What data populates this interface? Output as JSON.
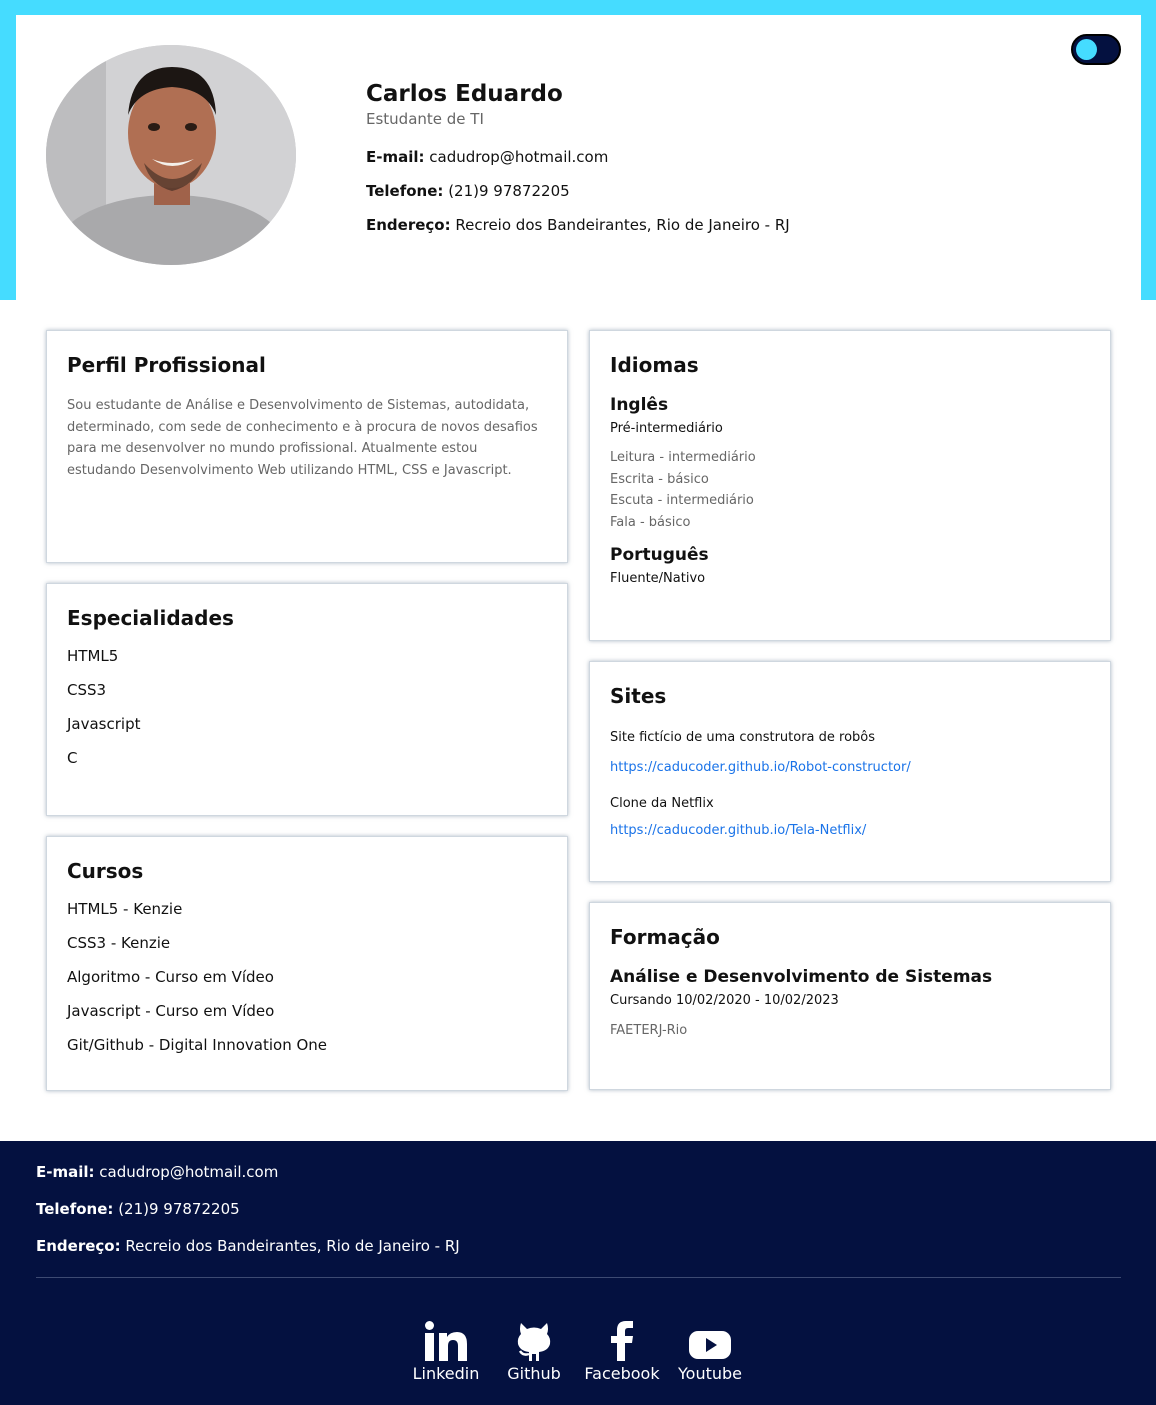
{
  "header": {
    "name": "Carlos Eduardo",
    "role": "Estudante de TI",
    "email_label": "E-mail:",
    "email": "cadudrop@hotmail.com",
    "phone_label": "Telefone:",
    "phone": "(21)9 97872205",
    "address_label": "Endereço:",
    "address": "Recreio dos Bandeirantes, Rio de Janeiro - RJ"
  },
  "theme_toggle": {
    "state": "dark",
    "icon": "toggle-switch-icon"
  },
  "profile": {
    "title": "Perfil Profissional",
    "text": "Sou estudante de Análise e Desenvolvimento de Sistemas, autodidata, determinado, com sede de conhecimento e à procura de novos desafios para me desenvolver no mundo profissional. Atualmente estou estudando Desenvolvimento Web utilizando HTML, CSS e Javascript."
  },
  "specialties": {
    "title": "Especialidades",
    "items": [
      "HTML5",
      "CSS3",
      "Javascript",
      "C"
    ]
  },
  "courses": {
    "title": "Cursos",
    "items": [
      "HTML5 - Kenzie",
      "CSS3 - Kenzie",
      "Algoritmo - Curso em Vídeo",
      "Javascript - Curso em Vídeo",
      "Git/Github - Digital Innovation One"
    ]
  },
  "languages": {
    "title": "Idiomas",
    "items": [
      {
        "name": "Inglês",
        "level": "Pré-intermediário",
        "skills": [
          "Leitura - intermediário",
          "Escrita - básico",
          "Escuta - intermediário",
          "Fala - básico"
        ]
      },
      {
        "name": "Português",
        "level": "Fluente/Nativo"
      }
    ]
  },
  "sites": {
    "title": "Sites",
    "items": [
      {
        "description": "Site fictício de uma construtora de robôs",
        "url": "https://caducoder.github.io/Robot-constructor/"
      },
      {
        "description": "Clone da Netflix",
        "url": "https://caducoder.github.io/Tela-Netflix/"
      }
    ]
  },
  "education": {
    "title": "Formação",
    "course": "Análise e Desenvolvimento de Sistemas",
    "status": "Cursando 10/02/2020 - 10/02/2023",
    "school": "FAETERJ-Rio"
  },
  "footer": {
    "email_label": "E-mail:",
    "email": "cadudrop@hotmail.com",
    "phone_label": "Telefone:",
    "phone": "(21)9 97872205",
    "address_label": "Endereço:",
    "address": "Recreio dos Bandeirantes, Rio de Janeiro - RJ",
    "socials": [
      {
        "label": "Linkedin",
        "icon": "linkedin-icon"
      },
      {
        "label": "Github",
        "icon": "github-icon"
      },
      {
        "label": "Facebook",
        "icon": "facebook-icon"
      },
      {
        "label": "Youtube",
        "icon": "youtube-icon"
      }
    ]
  },
  "colors": {
    "accent": "#45dcff",
    "footer_bg": "#041140",
    "link": "#1a73e8"
  }
}
